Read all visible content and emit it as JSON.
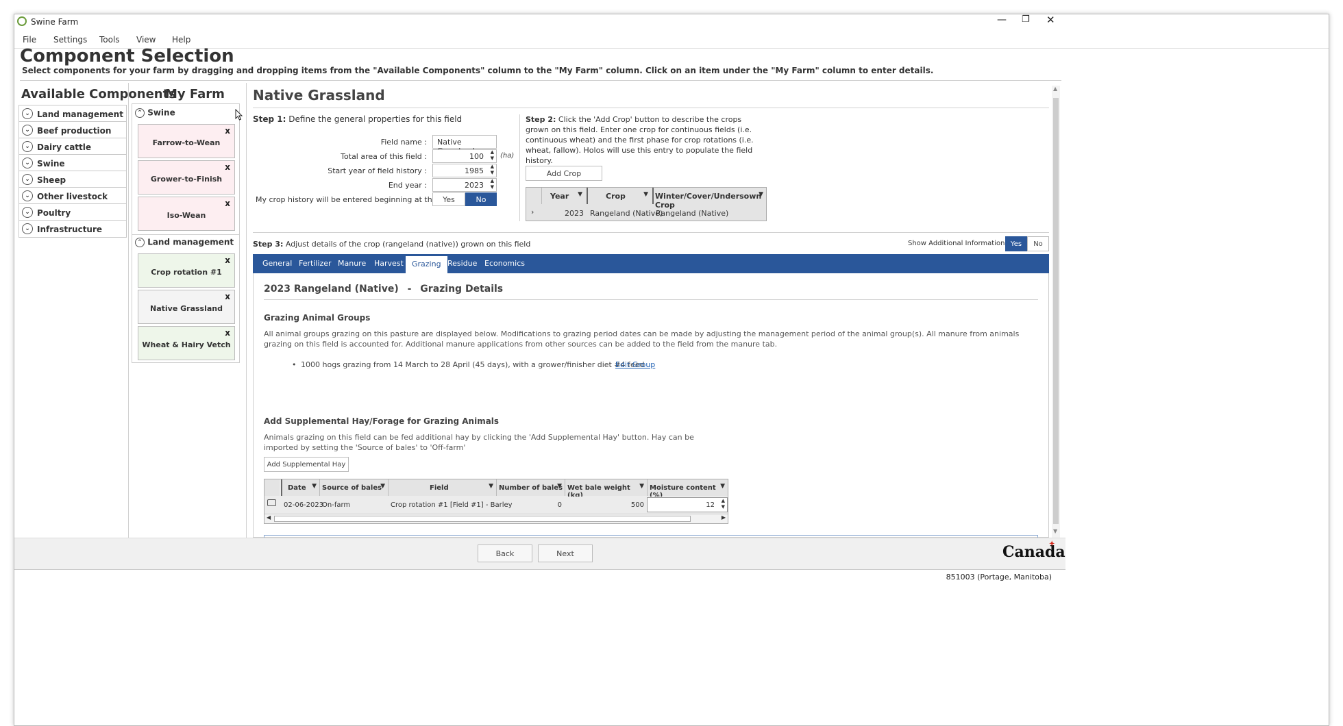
{
  "window": {
    "title": "Swine Farm"
  },
  "menu": [
    "File",
    "Settings",
    "Tools",
    "View",
    "Help"
  ],
  "page": {
    "title": "Component Selection",
    "subtitle": "Select components for your farm by dragging and dropping items from the \"Available Components\" column to the \"My Farm\" column. Click on an item under the \"My Farm\" column to enter details."
  },
  "available": {
    "title": "Available Components",
    "items": [
      "Land management",
      "Beef production",
      "Dairy cattle",
      "Swine",
      "Sheep",
      "Other livestock",
      "Poultry",
      "Infrastructure"
    ]
  },
  "myfarm": {
    "title": "My Farm",
    "groups": [
      {
        "label": "Swine",
        "cards": [
          "Farrow-to-Wean",
          "Grower-to-Finish",
          "Iso-Wean"
        ]
      },
      {
        "label": "Land management",
        "cards": [
          "Crop rotation #1",
          "Native Grassland",
          "Wheat & Hairy Vetch"
        ]
      }
    ],
    "close_glyph": "x"
  },
  "detail": {
    "title": "Native Grassland",
    "step1": {
      "bold": "Step 1:",
      "text": "Define the general properties for this field",
      "field_name_label": "Field name :",
      "field_name_value": "Native Grassland",
      "area_label": "Total area of this field :",
      "area_value": "100",
      "area_unit": "(ha)",
      "start_label": "Start year of field history :",
      "start_value": "1985",
      "end_label": "End year :",
      "end_value": "2023",
      "history_label": "My crop history will be entered beginning at the start year :",
      "yes": "Yes",
      "no": "No"
    },
    "step2": {
      "bold": "Step 2:",
      "text": "Click the 'Add Crop' button to describe the crops grown on this field. Enter one crop for continuous fields (i.e. continuous wheat) and the first phase for crop rotations (i.e. wheat, fallow). Holos will use this entry to populate the field history.",
      "add_crop": "Add Crop",
      "columns": [
        "Year",
        "Crop",
        "Winter/Cover/Undersown Crop"
      ],
      "rows": [
        {
          "year": "2023",
          "crop": "Rangeland (Native)",
          "cover": "Rangeland (Native)"
        }
      ]
    },
    "step3": {
      "bold": "Step 3:",
      "text": "Adjust details of the crop (rangeland (native)) grown on this field",
      "show_info_label": "Show Additional Information :",
      "yes": "Yes",
      "no": "No"
    },
    "tabs": [
      "General",
      "Fertilizer",
      "Manure",
      "Harvest",
      "Grazing",
      "Residue",
      "Economics"
    ],
    "active_tab": "Grazing",
    "grazing": {
      "heading_left": "2023 Rangeland (Native)",
      "heading_dash": "-",
      "heading_right": "Grazing Details",
      "groups_title": "Grazing Animal Groups",
      "groups_text": "All animal groups grazing on this pasture are displayed below. Modifications to grazing period dates can be made by adjusting the management period of the animal group(s). All manure from animals grazing on this field is accounted for. Additional manure applications from other sources can be added to the field from the manure tab.",
      "group_item": "1000 hogs grazing from 14 March to 28 April (45 days), with a grower/finisher diet #4 feed",
      "edit_group": "Edit  Group",
      "hay_title": "Add Supplemental Hay/Forage for Grazing Animals",
      "hay_text": "Animals grazing on this field can be fed additional hay by clicking the 'Add Supplemental Hay' button. Hay can be imported by setting the 'Source of bales' to 'Off-farm'",
      "hay_button": "Add Supplemental Hay",
      "hay_columns": [
        "Date",
        "Source of bales",
        "Field",
        "Number of bales",
        "Wet bale weight (kg)",
        "Moisture content (%)"
      ],
      "hay_rows": [
        {
          "date": "02-06-2023",
          "source": "On-farm",
          "field": "Crop rotation #1 [Field #1] - Barley",
          "bales": "0",
          "weight": "500",
          "moisture": "12"
        }
      ]
    }
  },
  "footer": {
    "back": "Back",
    "next": "Next",
    "brand": "Canada"
  },
  "status": {
    "text": "851003 (Portage, Manitoba)"
  },
  "colors": {
    "accent": "#2a579a",
    "pink_card": "#fdeef1",
    "green_card": "#eef6ea"
  }
}
